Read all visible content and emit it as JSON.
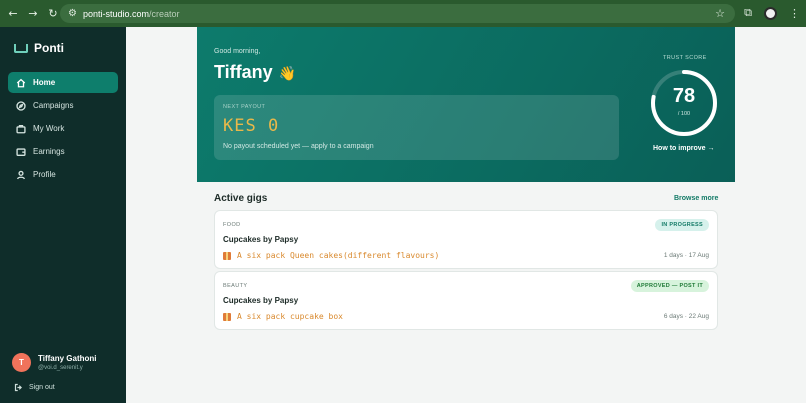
{
  "browser": {
    "url_host": "ponti-studio.com",
    "url_path": "/creator"
  },
  "brand": {
    "name": "Ponti"
  },
  "sidebar": {
    "items": [
      {
        "label": "Home",
        "icon": "home-icon",
        "active": true
      },
      {
        "label": "Campaigns",
        "icon": "compass-icon",
        "active": false
      },
      {
        "label": "My Work",
        "icon": "briefcase-icon",
        "active": false
      },
      {
        "label": "Earnings",
        "icon": "wallet-icon",
        "active": false
      },
      {
        "label": "Profile",
        "icon": "user-icon",
        "active": false
      }
    ],
    "user": {
      "initial": "T",
      "name": "Tiffany Gathoni",
      "handle": "@voi.d_serenit.y"
    },
    "signout_label": "Sign out"
  },
  "hero": {
    "greeting": "Good morning,",
    "name": "Tiffany",
    "wave": "👋",
    "payout_label": "NEXT PAYOUT",
    "payout_amount": "KES 0",
    "payout_note": "No payout scheduled yet — apply to a campaign",
    "trust_label": "TRUST SCORE",
    "trust_score": 78,
    "trust_max": "/ 100",
    "improve_label": "How to improve →"
  },
  "gigs": {
    "title": "Active gigs",
    "browse_label": "Browse more",
    "items": [
      {
        "category": "FOOD",
        "title": "Cupcakes by Papsy",
        "gift": "A six pack Queen cakes(different flavours)",
        "status": "IN PROGRESS",
        "meta": "1 days · 17 Aug"
      },
      {
        "category": "BEAUTY",
        "title": "Cupcakes by Papsy",
        "gift": "A six pack cupcake box",
        "status": "APPROVED — POST IT",
        "meta": "6 days · 22 Aug"
      }
    ]
  },
  "colors": {
    "sidebar_bg": "#0f2d2a",
    "accent": "#0e7e6c",
    "payout_amount": "#e9b84a"
  }
}
